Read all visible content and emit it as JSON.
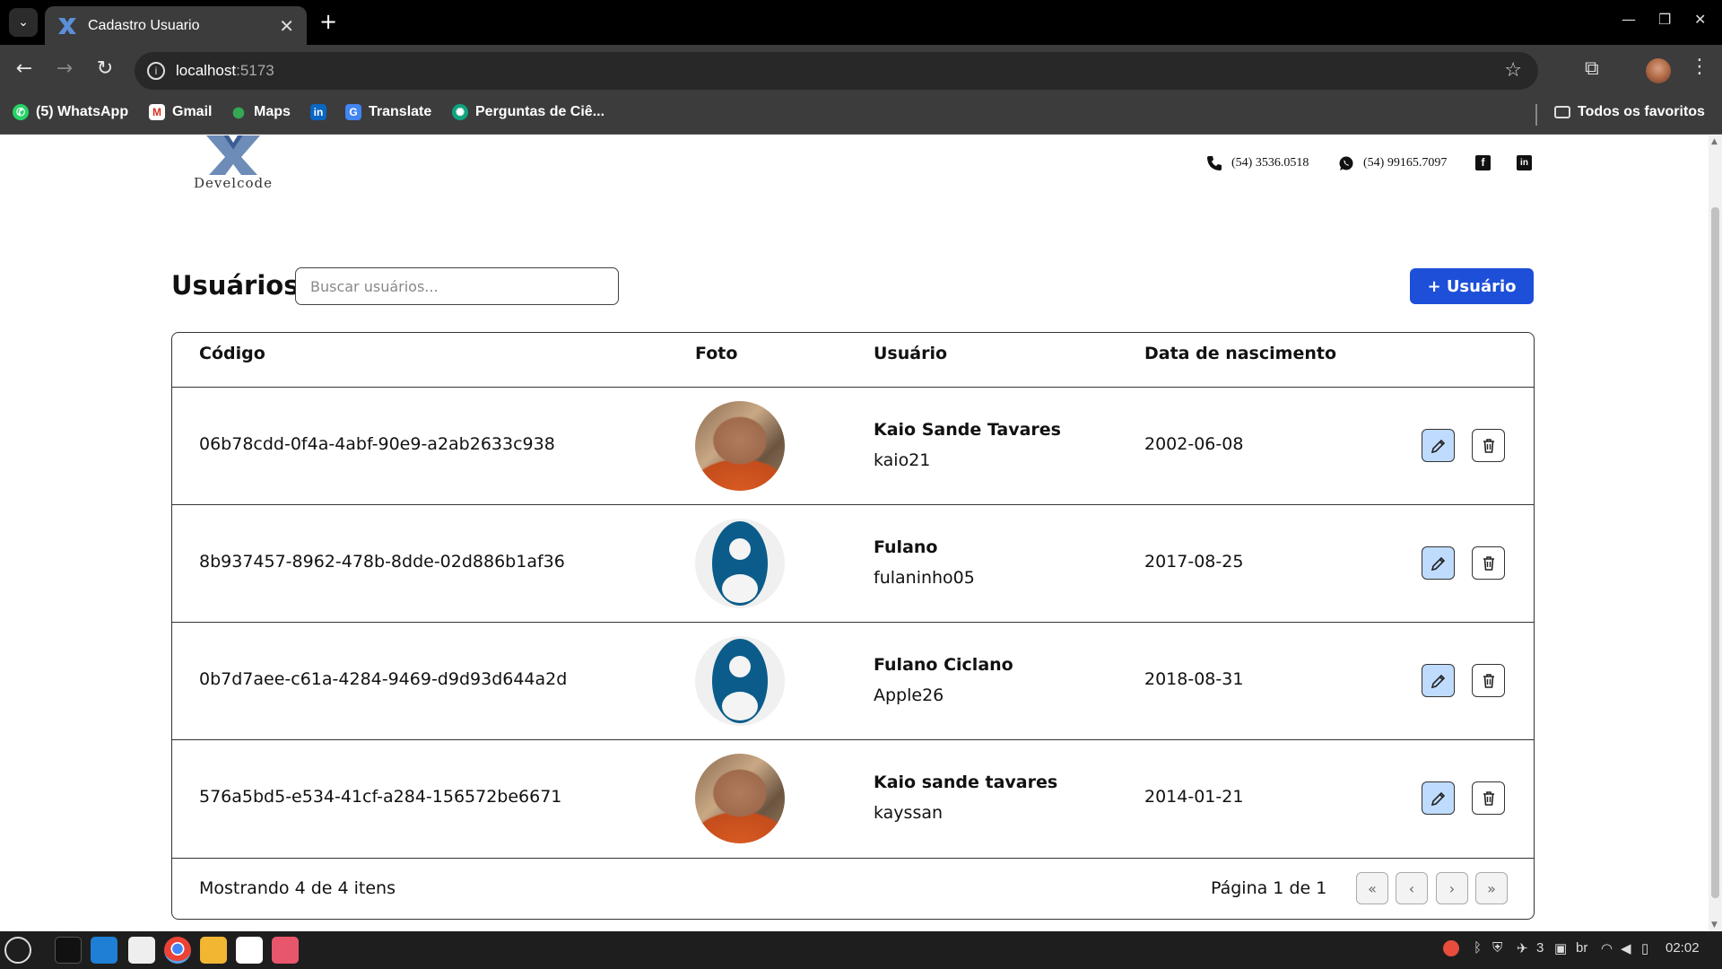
{
  "browser": {
    "tab_title": "Cadastro Usuario",
    "url_host": "localhost",
    "url_port": ":5173",
    "bookmarks": [
      "(5) WhatsApp",
      "Gmail",
      "Maps",
      "Translate",
      "Perguntas de Ciê..."
    ],
    "all_bookmarks": "Todos os favoritos"
  },
  "header": {
    "logo_text": "Develcode",
    "phone": "(54) 3536.0518",
    "whatsapp": "(54) 99165.7097"
  },
  "users": {
    "title": "Usuários",
    "search_placeholder": "Buscar usuários...",
    "add_label": "+ Usuário",
    "columns": {
      "code": "Código",
      "photo": "Foto",
      "user": "Usuário",
      "birth": "Data de nascimento"
    },
    "rows": [
      {
        "code": "06b78cdd-0f4a-4abf-90e9-a2ab2633c938",
        "name": "Kaio Sande Tavares",
        "login": "kaio21",
        "birth": "2002-06-08",
        "photo": "person"
      },
      {
        "code": "8b937457-8962-478b-8dde-02d886b1af36",
        "name": "Fulano",
        "login": "fulaninho05",
        "birth": "2017-08-25",
        "photo": "placeholder"
      },
      {
        "code": "0b7d7aee-c61a-4284-9469-d9d93d644a2d",
        "name": "Fulano Ciclano",
        "login": "Apple26",
        "birth": "2018-08-31",
        "photo": "placeholder"
      },
      {
        "code": "576a5bd5-e534-41cf-a284-156572be6671",
        "name": "Kaio sande tavares",
        "login": "kayssan",
        "birth": "2014-01-21",
        "photo": "person"
      }
    ],
    "showing": "Mostrando 4 de 4 itens",
    "page_info": "Página 1 de 1"
  },
  "taskbar": {
    "notification_count": "3",
    "keyboard_layout": "br",
    "time": "02:02"
  },
  "colors": {
    "accent": "#1d4fd8",
    "edit_bg": "#bfdbfe",
    "placeholder_avatar": "#0b5c8a"
  }
}
